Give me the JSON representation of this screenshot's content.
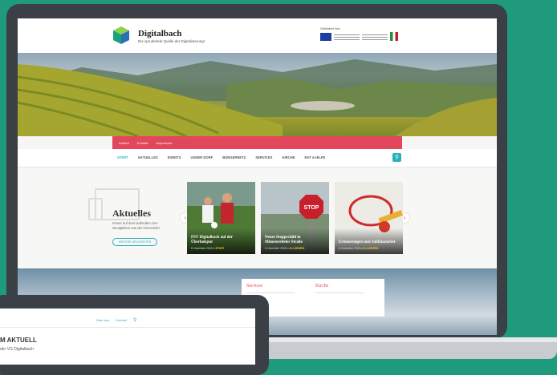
{
  "site": {
    "title": "Digitalbach",
    "tagline": "Die sprudelnde Quelle der Digitalisierung!",
    "funding_label": "Gefördert von:"
  },
  "util_nav": [
    "Anfahrt",
    "Kontakt",
    "Impressum"
  ],
  "main_nav": {
    "items": [
      "START",
      "AKTUELLES",
      "EVENTS",
      "UNSER DORF",
      "BÜRGERNETZ",
      "SERVICES",
      "KIRCHE",
      "RAT & HILFE"
    ],
    "active_index": 0
  },
  "news": {
    "title": "Aktuelles",
    "text": "Immer auf dem laufenden zum Neuigkeiten aus der Gemeinde!",
    "button_label": "WEITERE NEUIGKEITEN",
    "prev_arrow": "‹",
    "next_arrow": "›",
    "cards": [
      {
        "title": "FSV Digitalbach auf der Überholspur",
        "date": "8. November 2018 in",
        "category": "SPORT"
      },
      {
        "title": "Neues Stoppschild in Münstereifeler Straße",
        "date": "8. November 2018 in",
        "category": "ALLGEMEIN"
      },
      {
        "title": "Erinnerungen und Jubiläumsfest",
        "date": "8. November 2018 in",
        "category": "ALLGEMEIN"
      }
    ]
  },
  "lower": {
    "col1": "Services",
    "col2": "Kirche"
  },
  "phone": {
    "links": [
      "Über uns",
      "Kontakt"
    ],
    "search_icon": "⚲",
    "heading": "M AKTUELL",
    "subheading": "der VG Digitalbach"
  },
  "colors": {
    "background": "#1f9a7d",
    "accent": "#e2475b",
    "link": "#2ab0bf"
  }
}
